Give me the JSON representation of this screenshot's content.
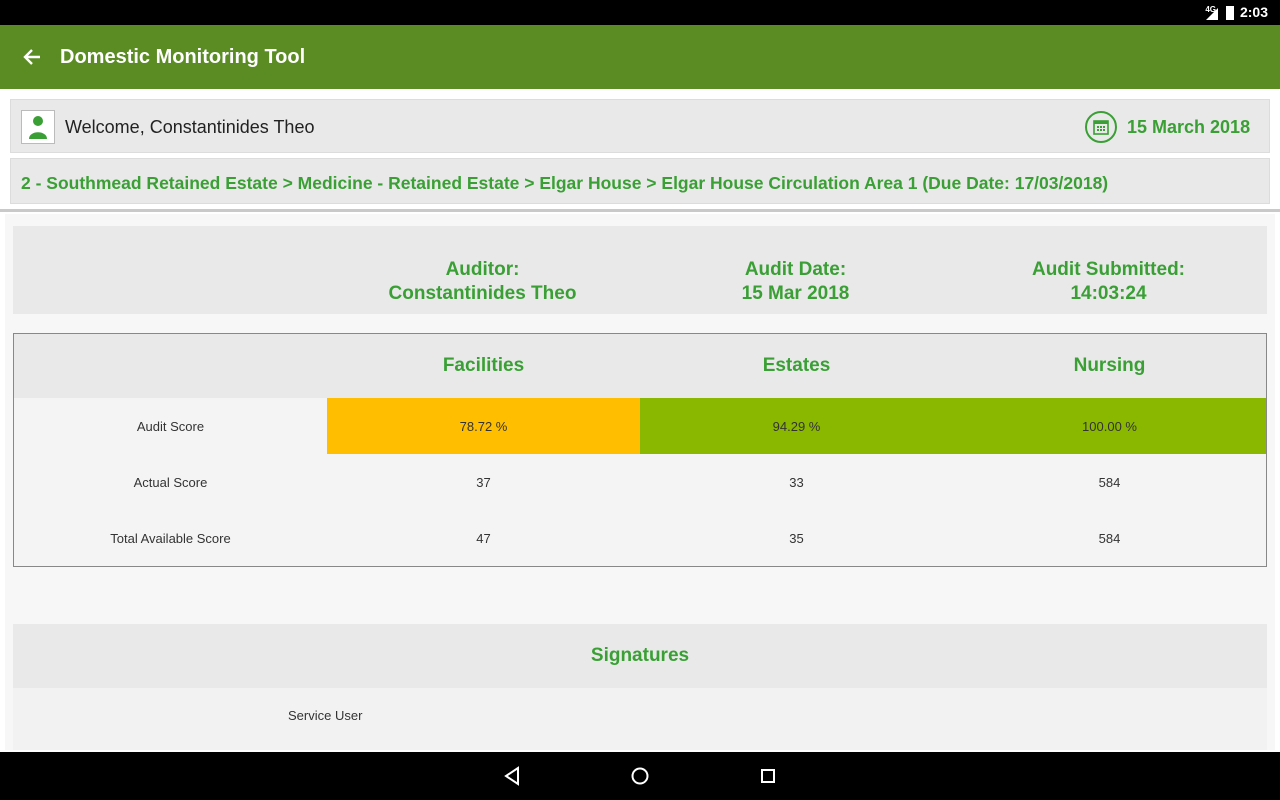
{
  "status_bar": {
    "network": "4G",
    "time": "2:03"
  },
  "app_bar": {
    "title": "Domestic Monitoring Tool",
    "back_icon": "arrow-back-icon"
  },
  "welcome": {
    "text": "Welcome, Constantinides Theo",
    "date": "15 March 2018",
    "avatar_icon": "user-avatar-icon",
    "calendar_icon": "calendar-icon"
  },
  "breadcrumb": "2 - Southmead Retained Estate > Medicine - Retained Estate > Elgar House > Elgar House Circulation Area 1 (Due Date: 17/03/2018)",
  "summary": {
    "auditor_label": "Auditor:",
    "auditor_value": "Constantinides Theo",
    "date_label": "Audit Date:",
    "date_value": "15 Mar 2018",
    "submitted_label": "Audit Submitted:",
    "submitted_value": "14:03:24"
  },
  "scores": {
    "headers": [
      "Facilities",
      "Estates",
      "Nursing"
    ],
    "rows": [
      {
        "label": "Audit Score",
        "values": [
          "78.72 %",
          "94.29 %",
          "100.00 %"
        ]
      },
      {
        "label": "Actual Score",
        "values": [
          "37",
          "33",
          "584"
        ]
      },
      {
        "label": "Total Available Score",
        "values": [
          "47",
          "35",
          "584"
        ]
      }
    ],
    "score_colors": [
      "#ffbf00",
      "#8ab800",
      "#8ab800"
    ]
  },
  "signatures": {
    "title": "Signatures",
    "service_user": "Service User"
  },
  "nav": {
    "back_icon": "nav-back-icon",
    "home_icon": "nav-home-icon",
    "recents_icon": "nav-recents-icon"
  },
  "colors": {
    "app_bar": "#5a8c23",
    "accent": "#3aa035"
  }
}
